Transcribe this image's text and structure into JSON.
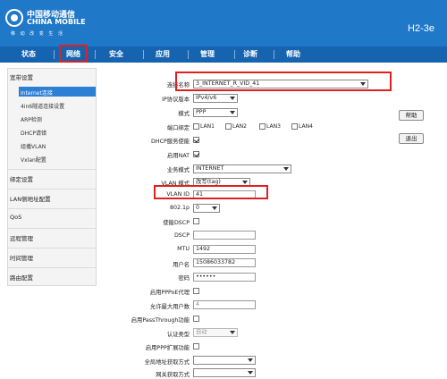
{
  "header": {
    "brand_cn": "中国移动通信",
    "brand_en": "CHINA MOBILE",
    "brand_sub": "移 动 改 变 生 活",
    "model": "H2-3e"
  },
  "nav": {
    "items": [
      "状态",
      "网络",
      "安全",
      "应用",
      "管理",
      "诊断",
      "帮助"
    ],
    "active": "网络"
  },
  "sidebar": {
    "groups": [
      {
        "label": "宽带设置",
        "items": [
          "Internet连接",
          "4in6隧道连接设置",
          "ARP检测",
          "DHCP请错",
          "组播VLAN",
          "Vxlan配置"
        ],
        "active": "Internet连接"
      },
      {
        "label": "绑定设置"
      },
      {
        "label": "LAN侧地址配置"
      },
      {
        "label": "QoS"
      },
      {
        "label": "远程管理"
      },
      {
        "label": "时间管理"
      },
      {
        "label": "路由配置"
      }
    ]
  },
  "form": {
    "connection_name": {
      "label": "连接名称",
      "value": "3_INTERNET_R_VID_41"
    },
    "ip_version": {
      "label": "IP协议版本",
      "value": "IPv4/v6"
    },
    "mode": {
      "label": "模式",
      "value": "PPP"
    },
    "port_binding": {
      "label": "端口绑定",
      "ports": [
        "LAN1",
        "LAN2",
        "LAN3",
        "LAN4"
      ]
    },
    "dhcp_service": {
      "label": "DHCP服务使能",
      "checked": true
    },
    "nat": {
      "label": "启用NAT",
      "checked": true
    },
    "service_mode": {
      "label": "业务模式",
      "value": "INTERNET"
    },
    "vlan_mode": {
      "label": "VLAN 模式",
      "value": "改写(tag)"
    },
    "vlan_id": {
      "label": "VLAN ID",
      "value": "41"
    },
    "dot1p": {
      "label": "802.1p",
      "value": "0"
    },
    "dscp_enable": {
      "label": "使能DSCP",
      "checked": false
    },
    "dscp": {
      "label": "DSCP",
      "value": ""
    },
    "mtu": {
      "label": "MTU",
      "value": "1492"
    },
    "username": {
      "label": "用户名",
      "value": "15086033782"
    },
    "password": {
      "label": "密码",
      "value": "••••••"
    },
    "pppoe_proxy": {
      "label": "启用PPPoE代理",
      "checked": false
    },
    "max_users": {
      "label": "允许最大用户数",
      "value": "4"
    },
    "passthrough": {
      "label": "启用PassThrough功能",
      "checked": false
    },
    "auth_type": {
      "label": "认证类型",
      "value": "自动"
    },
    "ppp_ext": {
      "label": "启用PPP扩展功能",
      "checked": false
    },
    "global_addr": {
      "label": "全局地址获取方式",
      "value": ""
    },
    "gateway_addr": {
      "label": "网关获取方式",
      "value": ""
    }
  },
  "buttons": {
    "help": "帮助",
    "logout": "退出"
  },
  "watermark": "luyouqiwang.net",
  "colors": {
    "header": "#1f78c8",
    "navbar": "#1664b0",
    "highlight": "#e02020",
    "active_item": "#2b7fd4"
  }
}
